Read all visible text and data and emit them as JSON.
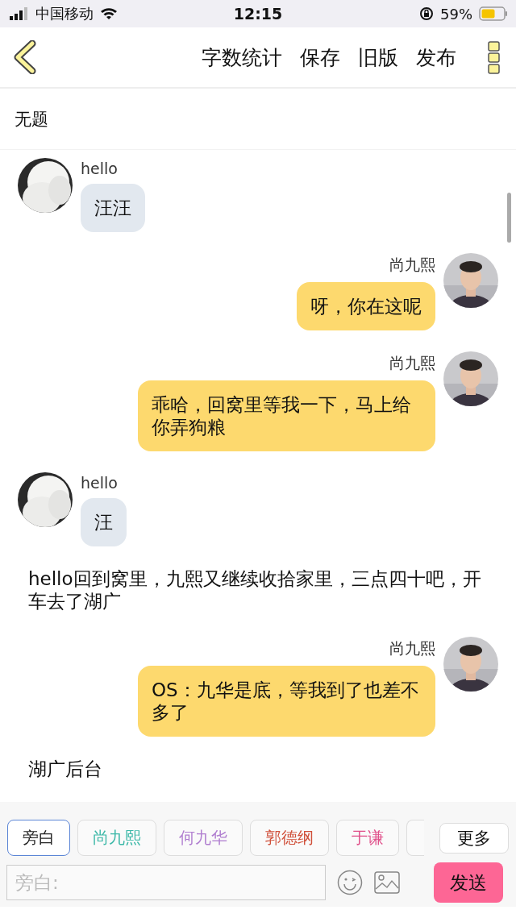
{
  "status_bar": {
    "carrier": "中国移动",
    "time": "12:15",
    "battery": "59%"
  },
  "toolbar": {
    "actions": [
      "字数统计",
      "保存",
      "旧版",
      "发布"
    ]
  },
  "title": "无题",
  "messages": [
    {
      "kind": "left",
      "name": "hello",
      "text": "汪汪"
    },
    {
      "kind": "right",
      "name": "尚九熙",
      "text": "呀，你在这呢"
    },
    {
      "kind": "right",
      "name": "尚九熙",
      "text": "乖哈，回窝里等我一下，马上给你弄狗粮"
    },
    {
      "kind": "left",
      "name": "hello",
      "text": "汪"
    },
    {
      "kind": "narration",
      "text": "hello回到窝里，九熙又继续收拾家里，三点四十吧，开车去了湖广"
    },
    {
      "kind": "right",
      "name": "尚九熙",
      "text": "OS：九华是底，等我到了也差不多了"
    },
    {
      "kind": "narration",
      "text": "湖广后台"
    }
  ],
  "characters": [
    {
      "label": "旁白",
      "selected": true,
      "color": "#222222"
    },
    {
      "label": "尚九熙",
      "selected": false,
      "color": "#3cb8a8"
    },
    {
      "label": "何九华",
      "selected": false,
      "color": "#b07ed0"
    },
    {
      "label": "郭德纲",
      "selected": false,
      "color": "#d0503a"
    },
    {
      "label": "于谦",
      "selected": false,
      "color": "#e0508a"
    }
  ],
  "more_button": "更多",
  "input": {
    "placeholder": "旁白:"
  },
  "send_button": "发送"
}
